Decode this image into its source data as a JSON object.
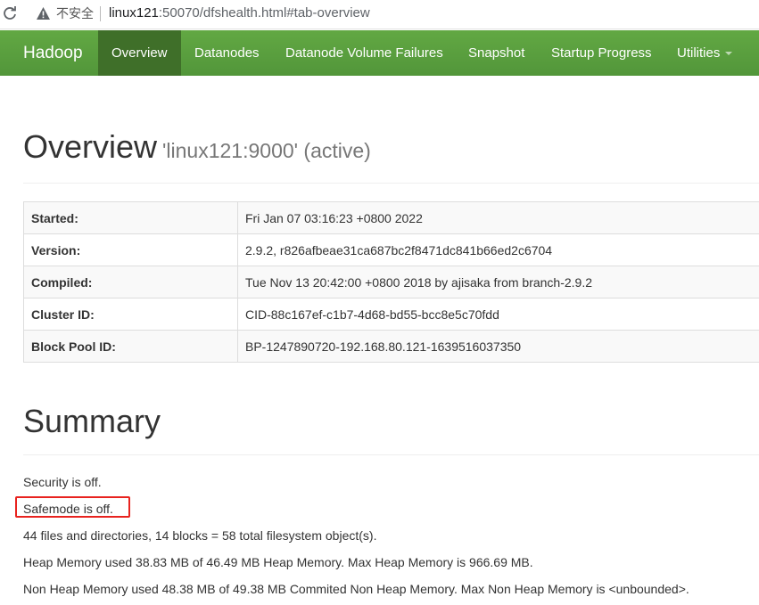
{
  "browser": {
    "security_label": "不安全",
    "url_host": "linux121",
    "url_rest": ":50070/dfshealth.html#tab-overview"
  },
  "navbar": {
    "brand": "Hadoop",
    "items": [
      {
        "label": "Overview",
        "active": true
      },
      {
        "label": "Datanodes"
      },
      {
        "label": "Datanode Volume Failures"
      },
      {
        "label": "Snapshot"
      },
      {
        "label": "Startup Progress"
      },
      {
        "label": "Utilities"
      }
    ],
    "color": "#5fa33e",
    "active_color": "#3f6f29"
  },
  "overview": {
    "title": "Overview",
    "subtitle": "'linux121:9000' (active)",
    "rows": [
      {
        "label": "Started:",
        "value": "Fri Jan 07 03:16:23 +0800 2022"
      },
      {
        "label": "Version:",
        "value": "2.9.2, r826afbeae31ca687bc2f8471dc841b66ed2c6704"
      },
      {
        "label": "Compiled:",
        "value": "Tue Nov 13 20:42:00 +0800 2018 by ajisaka from branch-2.9.2"
      },
      {
        "label": "Cluster ID:",
        "value": "CID-88c167ef-c1b7-4d68-bd55-bcc8e5c70fdd"
      },
      {
        "label": "Block Pool ID:",
        "value": "BP-1247890720-192.168.80.121-1639516037350"
      }
    ]
  },
  "summary": {
    "title": "Summary",
    "lines": [
      "Security is off.",
      "Safemode is off.",
      "44 files and directories, 14 blocks = 58 total filesystem object(s).",
      "Heap Memory used 38.83 MB of 46.49 MB Heap Memory. Max Heap Memory is 966.69 MB.",
      "Non Heap Memory used 48.38 MB of 49.38 MB Commited Non Heap Memory. Max Non Heap Memory is <unbounded>."
    ],
    "highlight_color": "#e8231f"
  }
}
